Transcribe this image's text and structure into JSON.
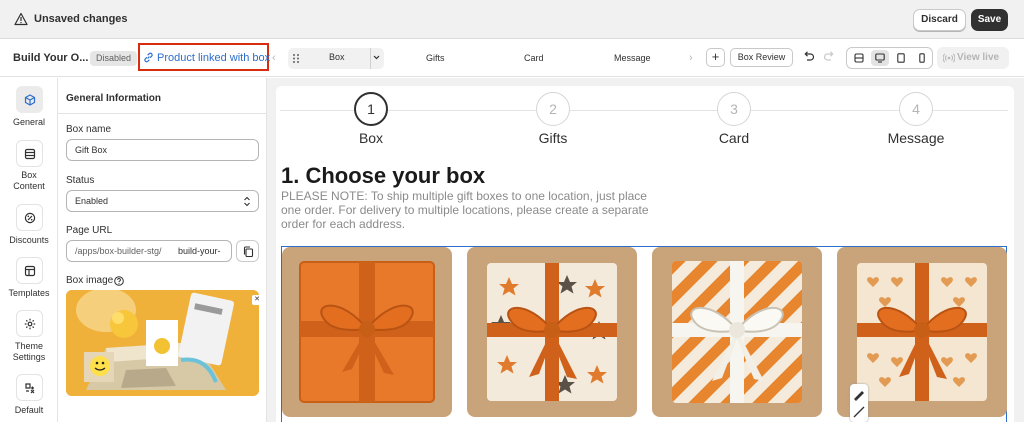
{
  "unsaved_bar": {
    "title": "Unsaved changes",
    "discard_label": "Discard",
    "save_label": "Save"
  },
  "toolbar": {
    "title": "Build Your O...",
    "status_badge": "Disabled",
    "linked_product": "Product linked with box",
    "step_select_value": "Box",
    "steps": [
      "Gifts",
      "Card",
      "Message"
    ],
    "box_review_label": "Box Review",
    "view_live_label": "View live"
  },
  "sidebar": {
    "items": [
      {
        "label": "General",
        "icon": "cube-icon",
        "active": true
      },
      {
        "label": "Box Content",
        "icon": "list-icon",
        "active": false
      },
      {
        "label": "Discounts",
        "icon": "discount-icon",
        "active": false
      },
      {
        "label": "Templates",
        "icon": "template-icon",
        "active": false
      },
      {
        "label": "Theme Settings",
        "icon": "gear-icon",
        "active": false
      },
      {
        "label": "Default",
        "icon": "default-icon",
        "active": false
      }
    ]
  },
  "settings": {
    "section_title": "General Information",
    "box_name_label": "Box name",
    "box_name_value": "Gift Box",
    "status_label": "Status",
    "status_value": "Enabled",
    "page_url_label": "Page URL",
    "page_url_prefix": "/apps/box-builder-stg/",
    "page_url_slug": "build-your-",
    "box_image_label": "Box image"
  },
  "preview": {
    "steps": [
      {
        "number": "1",
        "label": "Box"
      },
      {
        "number": "2",
        "label": "Gifts"
      },
      {
        "number": "3",
        "label": "Card"
      },
      {
        "number": "4",
        "label": "Message"
      }
    ],
    "heading": "1. Choose your box",
    "note": "PLEASE NOTE: To ship multiple gift boxes to one location, just place one order. For delivery to multiple locations, please create a separate order for each address.",
    "products": [
      {
        "pattern": "solid-orange"
      },
      {
        "pattern": "stars"
      },
      {
        "pattern": "stripes"
      },
      {
        "pattern": "hearts"
      }
    ]
  },
  "colors": {
    "accent_link": "#2c6ecb",
    "highlight_border": "#d72c0d",
    "primary_button": "#303030",
    "box_orange": "#e8782a"
  }
}
